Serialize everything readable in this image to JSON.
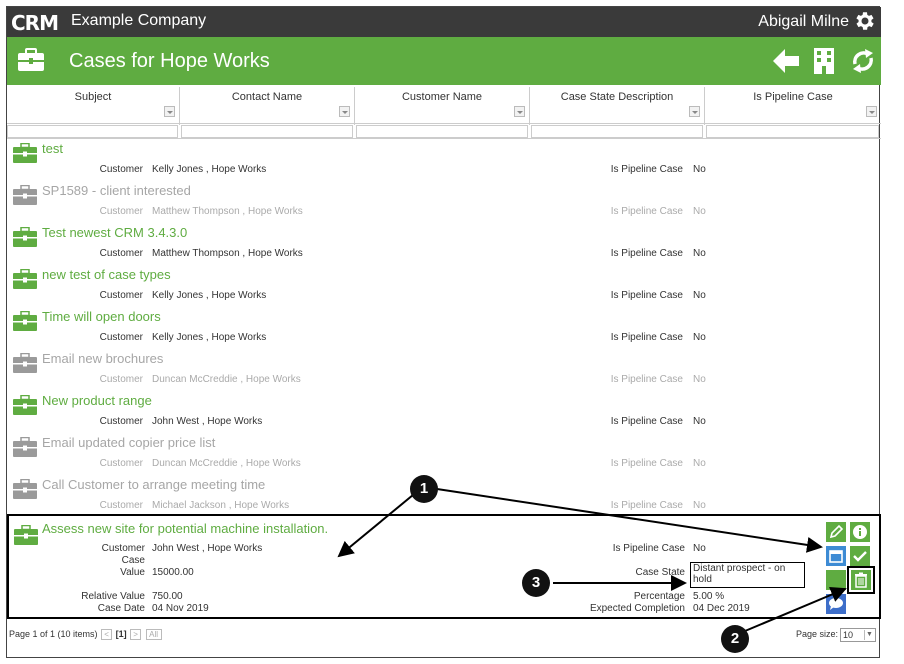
{
  "app": {
    "logo": "CRM",
    "company": "Example Company",
    "user": "Abigail Milne"
  },
  "page": {
    "title": "Cases for Hope Works"
  },
  "columns": [
    "Subject",
    "Contact Name",
    "Customer Name",
    "Case State Description",
    "Is Pipeline Case"
  ],
  "labels": {
    "customer": "Customer",
    "pipeline": "Is Pipeline Case",
    "case_value_1": "Case",
    "case_value_2": "Value",
    "relative_value": "Relative Value",
    "case_date": "Case Date",
    "case_state": "Case State",
    "percentage": "Percentage",
    "expected_completion": "Expected Completion"
  },
  "cases": [
    {
      "title": "test",
      "customer": "Kelly Jones , Hope Works",
      "pipeline": "No",
      "active": true
    },
    {
      "title": "SP1589 - client interested",
      "customer": "Matthew Thompson , Hope Works",
      "pipeline": "No",
      "active": false
    },
    {
      "title": "Test newest CRM 3.4.3.0",
      "customer": "Matthew Thompson , Hope Works",
      "pipeline": "No",
      "active": true
    },
    {
      "title": "new test of case types",
      "customer": "Kelly Jones , Hope Works",
      "pipeline": "No",
      "active": true
    },
    {
      "title": "Time will open doors",
      "customer": "Kelly Jones , Hope Works",
      "pipeline": "No",
      "active": true
    },
    {
      "title": "Email new brochures",
      "customer": "Duncan McCreddie , Hope Works",
      "pipeline": "No",
      "active": false
    },
    {
      "title": "New product range",
      "customer": "John West , Hope Works",
      "pipeline": "No",
      "active": true
    },
    {
      "title": "Email updated copier price list",
      "customer": "Duncan McCreddie , Hope Works",
      "pipeline": "No",
      "active": false
    },
    {
      "title": "Call Customer to arrange meeting time",
      "customer": "Michael Jackson , Hope Works",
      "pipeline": "No",
      "active": false
    }
  ],
  "selected_case": {
    "title": "Assess new site for potential machine installation.",
    "customer": "John West , Hope Works",
    "pipeline": "No",
    "case_value": "15000.00",
    "relative_value": "750.00",
    "case_date": "04 Nov 2019",
    "case_state_1": "Distant prospect - on",
    "case_state_2": "hold",
    "percentage": "5.00 %",
    "expected_completion": "04 Dec 2019"
  },
  "pager": {
    "info": "Page 1 of 1 (10 items)",
    "current": "[1]",
    "all": "All",
    "page_size_label": "Page size:",
    "page_size": "10"
  },
  "callouts": [
    "1",
    "2",
    "3"
  ],
  "colors": {
    "green": "#5fac41",
    "dark": "#3a3a3a",
    "blue": "#3d8bd4",
    "grey_icon": "#9a9a9a"
  }
}
